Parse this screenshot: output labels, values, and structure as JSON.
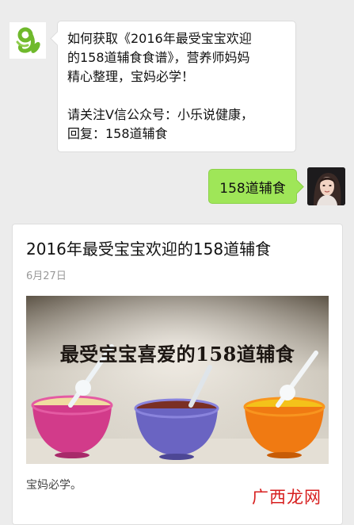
{
  "incoming_message": {
    "lines": [
      "如何获取《2016年最受宝宝欢迎",
      "的158道辅食食谱》，营养师妈妈",
      "精心整理，宝妈必学！",
      "请关注V信公众号：小乐说健康，",
      "回复：158道辅食"
    ]
  },
  "outgoing_message": {
    "text": "158道辅食"
  },
  "article_card": {
    "title": "2016年最受宝宝欢迎的158道辅食",
    "date": "6月27日",
    "image_headline": "最受宝宝喜爱的158道辅食",
    "description": "宝妈必学。"
  },
  "watermark": {
    "text": "广西龙网"
  },
  "colors": {
    "chat_background": "#ececec",
    "outgoing_bubble": "#9fe658",
    "logo_green": "#6fb92c",
    "watermark_red": "#d71f1f"
  },
  "icons": {
    "sender_avatar": "green-logo-avatar",
    "user_avatar": "user-photo-avatar"
  }
}
